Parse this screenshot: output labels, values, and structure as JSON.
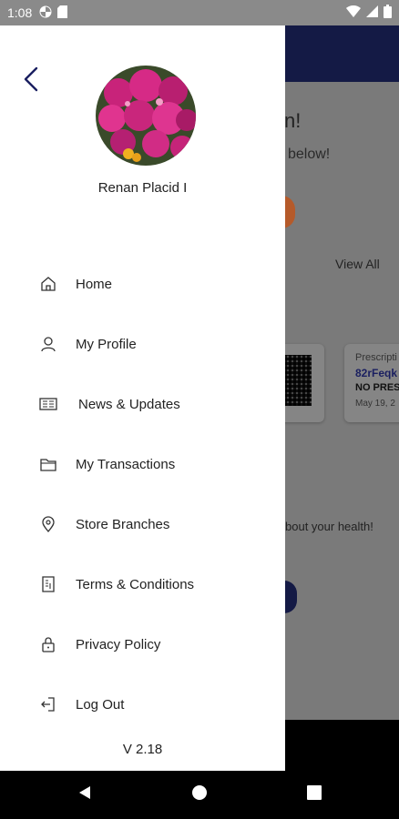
{
  "status_bar": {
    "time": "1:08",
    "left_icons": [
      "pinwheel-icon",
      "sd-card-icon"
    ],
    "right_icons": [
      "wifi-icon",
      "signal-icon",
      "battery-icon"
    ]
  },
  "background_app": {
    "greeting_fragment": "n!",
    "subtitle_fragment": "below!",
    "view_all_label": "View All",
    "prescription_card": {
      "label": "Prescripti",
      "code": "82rFeqk",
      "status": "NO PRES",
      "date": "May 19, 2"
    },
    "health_fragment": "bout your health!"
  },
  "drawer": {
    "back_icon": "chevron-left-icon",
    "user_name": "Renan Placid I",
    "menu_items": [
      {
        "label": "Home",
        "icon": "home-icon"
      },
      {
        "label": "My Profile",
        "icon": "user-icon"
      },
      {
        "label": "News & Updates",
        "icon": "news-icon"
      },
      {
        "label": "My Transactions",
        "icon": "wallet-icon"
      },
      {
        "label": "Store Branches",
        "icon": "location-pin-icon"
      },
      {
        "label": "Terms & Conditions",
        "icon": "document-icon"
      },
      {
        "label": "Privacy Policy",
        "icon": "lock-icon"
      },
      {
        "label": "Log Out",
        "icon": "logout-icon"
      }
    ],
    "version": "V 2.18"
  },
  "nav_bar": {
    "buttons": [
      "back-triangle-icon",
      "home-circle-icon",
      "recents-square-icon"
    ]
  },
  "colors": {
    "accent": "#1a1f60",
    "header_dark": "#141a45",
    "drawer_bg": "#ffffff"
  }
}
